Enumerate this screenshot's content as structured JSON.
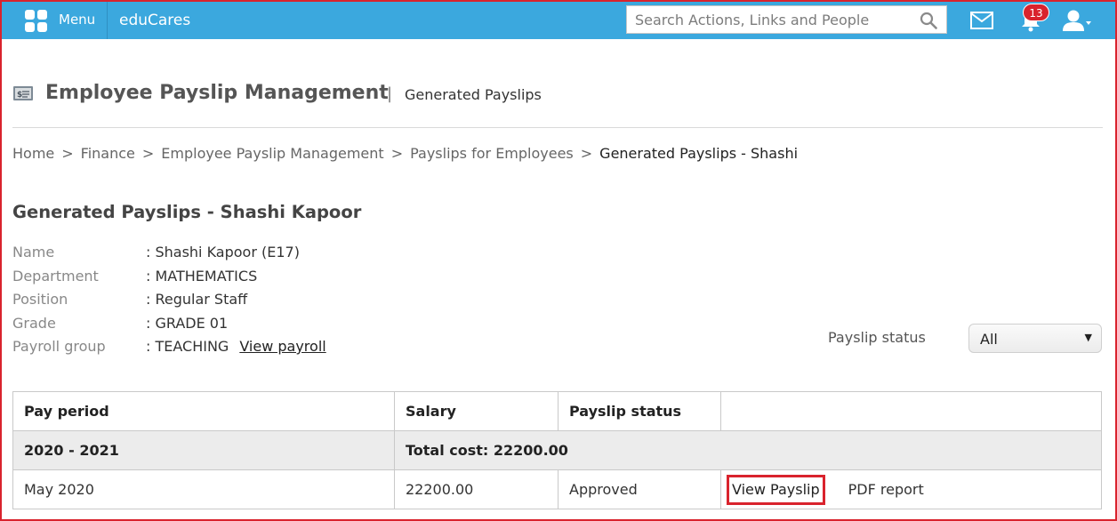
{
  "topbar": {
    "menu_label": "Menu",
    "brand": "eduCares",
    "search_placeholder": "Search Actions, Links and People",
    "notification_count": "13",
    "accent_color": "#3ba8de"
  },
  "header": {
    "title": "Employee Payslip Management",
    "separator": "|",
    "subtitle": "Generated Payslips"
  },
  "breadcrumb": {
    "items": [
      "Home",
      "Finance",
      "Employee Payslip Management",
      "Payslips for Employees",
      "Generated Payslips - Shashi"
    ],
    "separator": ">"
  },
  "section_title": "Generated Payslips - Shashi Kapoor",
  "employee": {
    "fields": [
      {
        "label": "Name",
        "value": ": Shashi Kapoor (E17)"
      },
      {
        "label": "Department",
        "value": ": MATHEMATICS"
      },
      {
        "label": "Position",
        "value": ": Regular Staff"
      },
      {
        "label": "Grade",
        "value": ": GRADE 01"
      },
      {
        "label": "Payroll group",
        "value": ": TEACHING"
      }
    ],
    "view_payroll_label": "View payroll"
  },
  "filter": {
    "label": "Payslip status",
    "selected": "All"
  },
  "table": {
    "headers": [
      "Pay period",
      "Salary",
      "Payslip status",
      ""
    ],
    "group": {
      "period": "2020 - 2021",
      "total": "Total cost: 22200.00"
    },
    "rows": [
      {
        "period": "May 2020",
        "salary": "22200.00",
        "status": "Approved",
        "view_label": "View Payslip",
        "pdf_label": "PDF report"
      }
    ]
  }
}
